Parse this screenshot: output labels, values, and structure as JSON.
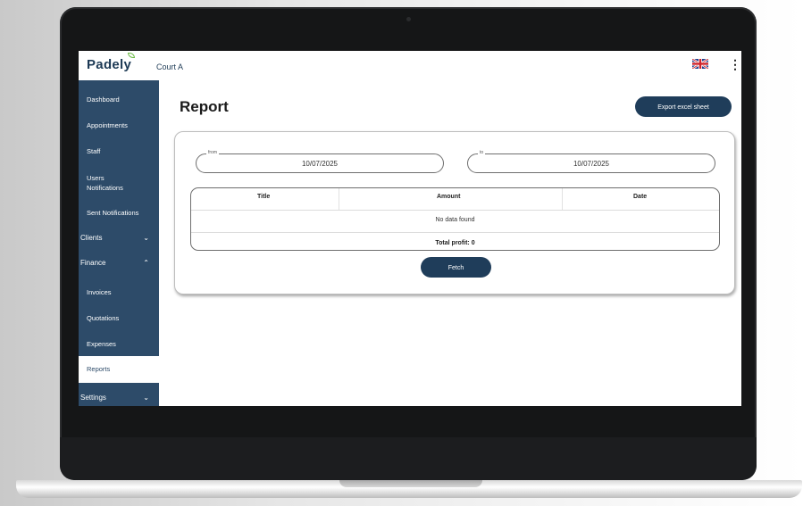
{
  "header": {
    "logo": "Padely",
    "court": "Court A",
    "flag_icon": "uk-flag-icon",
    "menu_icon": "kebab-menu-icon"
  },
  "sidebar": {
    "items": [
      {
        "label": "Dashboard"
      },
      {
        "label": "Appointments"
      },
      {
        "label": "Staff"
      },
      {
        "label": "Users"
      },
      {
        "label": "Notifications"
      },
      {
        "label": "Sent Notifications"
      },
      {
        "label": "Clients",
        "chevron": "⌄"
      },
      {
        "label": "Finance",
        "chevron": "⌃"
      },
      {
        "label": "Invoices"
      },
      {
        "label": "Quotations"
      },
      {
        "label": "Expenses"
      },
      {
        "label": "Reports"
      },
      {
        "label": "Settings",
        "chevron": "⌄"
      }
    ]
  },
  "main": {
    "title": "Report",
    "export_label": "Export excel sheet",
    "from_label": "from",
    "from_value": "10/07/2025",
    "to_label": "to",
    "to_value": "10/07/2025",
    "table": {
      "headers": [
        "Title",
        "Amount",
        "Date"
      ],
      "empty_text": "No data found",
      "total_text": "Total profit:  0"
    },
    "fetch_label": "Fetch"
  },
  "colors": {
    "sidebar_bg": "#2d4b69",
    "button_bg": "#1f3d5a",
    "logo_accent": "#6ebd4a"
  }
}
